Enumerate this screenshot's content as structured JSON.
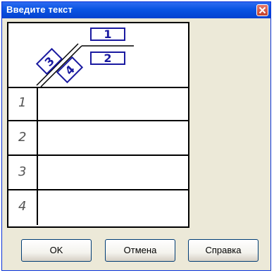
{
  "dialog": {
    "title": "Введите текст"
  },
  "colors": {
    "titlebar": "#0a54e3",
    "window_bg": "#ece9d8",
    "close_button": "#c4422b",
    "diagram_blue": "#1a1aa0"
  },
  "icons": {
    "close": "close-icon"
  },
  "diagram": {
    "label_1": "1",
    "label_2": "2",
    "label_3": "3",
    "label_4": "4"
  },
  "rows": [
    {
      "number": "1",
      "text": ""
    },
    {
      "number": "2",
      "text": ""
    },
    {
      "number": "3",
      "text": ""
    },
    {
      "number": "4",
      "text": ""
    }
  ],
  "buttons": {
    "ok": "OK",
    "cancel": "Отмена",
    "help": "Справка"
  }
}
